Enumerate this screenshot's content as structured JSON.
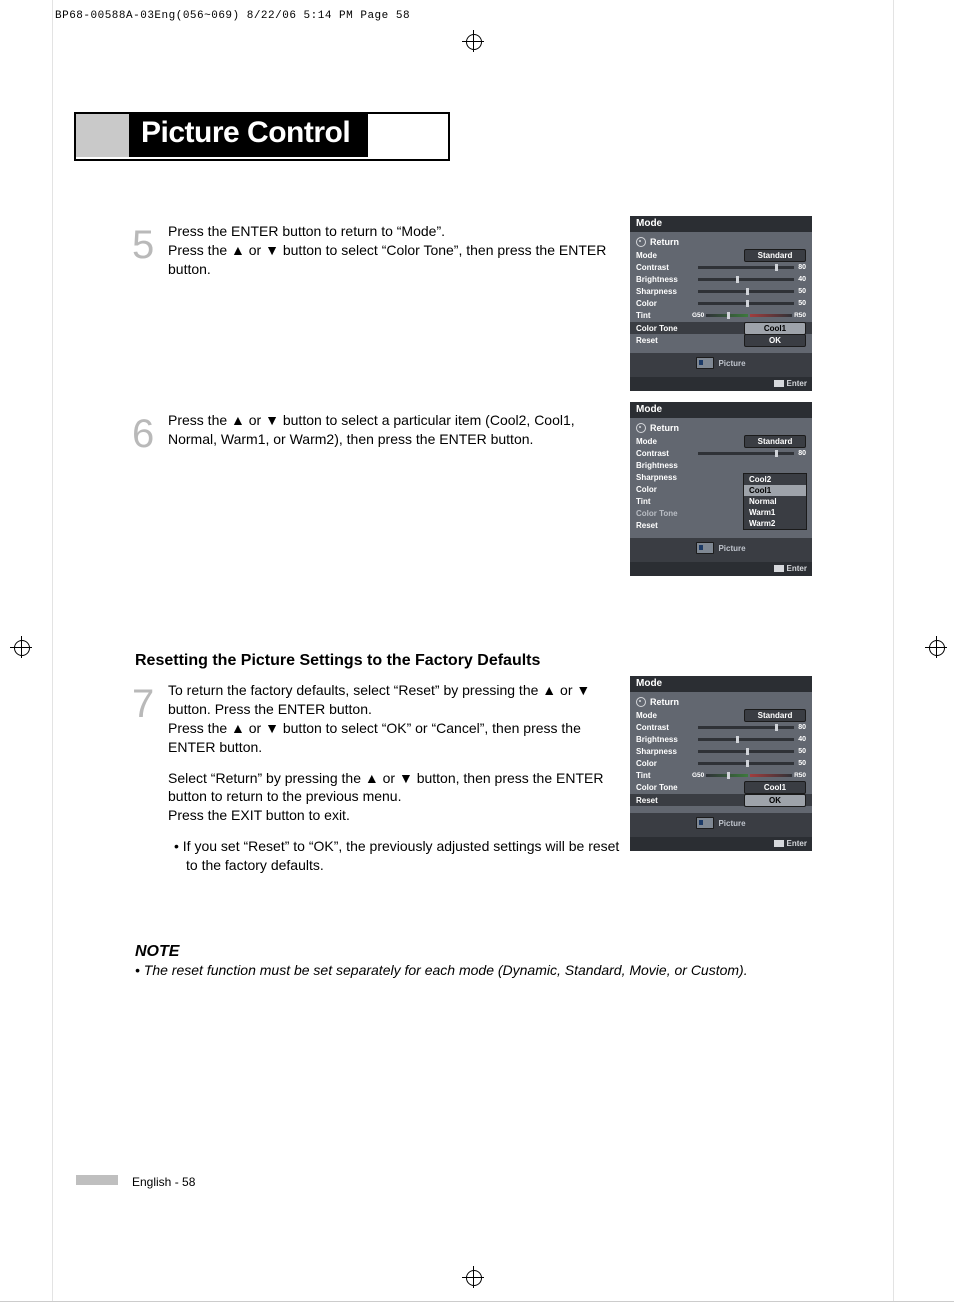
{
  "header_crop": "BP68-00588A-03Eng(056~069)  8/22/06  5:14 PM  Page 58",
  "page_title": "Picture Control",
  "step5": {
    "num": "5",
    "line1": "Press the ENTER button to return to “Mode”.",
    "line2": "Press the ▲ or ▼ button to select “Color Tone”, then press the ENTER button."
  },
  "step6": {
    "num": "6",
    "line1": "Press the ▲ or ▼ button to select a particular item (Cool2, Cool1, Normal, Warm1, or Warm2), then press the ENTER button."
  },
  "subhead": "Resetting the Picture Settings to the Factory Defaults",
  "step7": {
    "num": "7",
    "p1": "To return the factory defaults, select “Reset” by pressing the ▲ or ▼ button. Press the ENTER button.",
    "p2": "Press the ▲ or ▼ button to select “OK” or “Cancel”, then press the ENTER button.",
    "p3": "Select “Return” by pressing the ▲ or ▼ button, then press the ENTER button to return to the previous menu.",
    "p4": "Press the EXIT button to exit.",
    "bullet": "If you set “Reset” to “OK”, the previously adjusted settings will be reset to the factory defaults."
  },
  "note_head": "NOTE",
  "note_body": "•  The reset function must be set separately for each mode (Dynamic, Standard, Movie, or Custom).",
  "footer": "English - 58",
  "osd": {
    "menu_title": "Mode",
    "return": "Return",
    "mode": {
      "label": "Mode",
      "value": "Standard"
    },
    "contrast": {
      "label": "Contrast",
      "value": "80",
      "pct": 80
    },
    "brightness": {
      "label": "Brightness",
      "value": "40",
      "pct": 40
    },
    "sharpness": {
      "label": "Sharpness",
      "value": "50",
      "pct": 50
    },
    "color": {
      "label": "Color",
      "value": "50",
      "pct": 50
    },
    "tint": {
      "label": "Tint",
      "g": "G50",
      "r": "R50"
    },
    "color_tone": {
      "label": "Color Tone",
      "value": "Cool1"
    },
    "reset": {
      "label": "Reset",
      "value": "OK"
    },
    "picture": "Picture",
    "enter": "Enter",
    "dropdown": [
      "Cool2",
      "Cool1",
      "Normal",
      "Warm1",
      "Warm2"
    ]
  }
}
